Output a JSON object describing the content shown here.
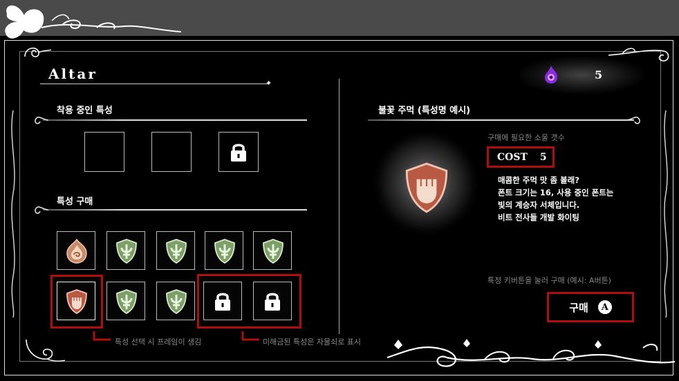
{
  "window": {
    "title": "Altar"
  },
  "currency": {
    "icon": "soul-flame-icon",
    "value": "5"
  },
  "equipped": {
    "label": "착용 중인 특성",
    "slots": [
      {
        "state": "empty"
      },
      {
        "state": "empty"
      },
      {
        "state": "locked",
        "icon": "lock-icon"
      }
    ]
  },
  "shop": {
    "label": "특성 구매",
    "rows": [
      [
        {
          "icon": "flame-crest-icon",
          "state": "available"
        },
        {
          "icon": "green-shield-icon",
          "state": "available"
        },
        {
          "icon": "green-shield-icon",
          "state": "available"
        },
        {
          "icon": "green-shield-icon",
          "state": "available"
        },
        {
          "icon": "green-shield-icon",
          "state": "available"
        }
      ],
      [
        {
          "icon": "fist-shield-icon",
          "state": "selected"
        },
        {
          "icon": "green-shield-icon",
          "state": "available"
        },
        {
          "icon": "green-shield-icon",
          "state": "available"
        },
        {
          "icon": "lock-icon",
          "state": "locked"
        },
        {
          "icon": "lock-icon",
          "state": "locked"
        }
      ]
    ]
  },
  "annotations": {
    "selected_note": "특성 선택 시 프레임이 생김",
    "locked_note": "미해금된 특성은 자물쇠로 표시"
  },
  "detail": {
    "name": "불꽃 주먹 (특성명 예시)",
    "icon": "fist-shield-icon",
    "cost_hint": "구매에 필요한 소울 갯수",
    "cost_label": "COST",
    "cost_value": "5",
    "description": [
      "매콤한 주먹 맛 좀 볼래?",
      "폰트 크기는 16, 사용 중인 폰트는",
      "빛의 계승자 서체입니다.",
      "비트 전사들 개발 화이팅"
    ],
    "buy_hint": "특정 키버튼을 눌러 구매 (예시: A버튼)",
    "buy_label": "구매",
    "buy_key": "A"
  },
  "colors": {
    "highlight_red": "#b00d0d",
    "background": "#000000",
    "text": "#ffffff",
    "muted_text": "#888888"
  }
}
